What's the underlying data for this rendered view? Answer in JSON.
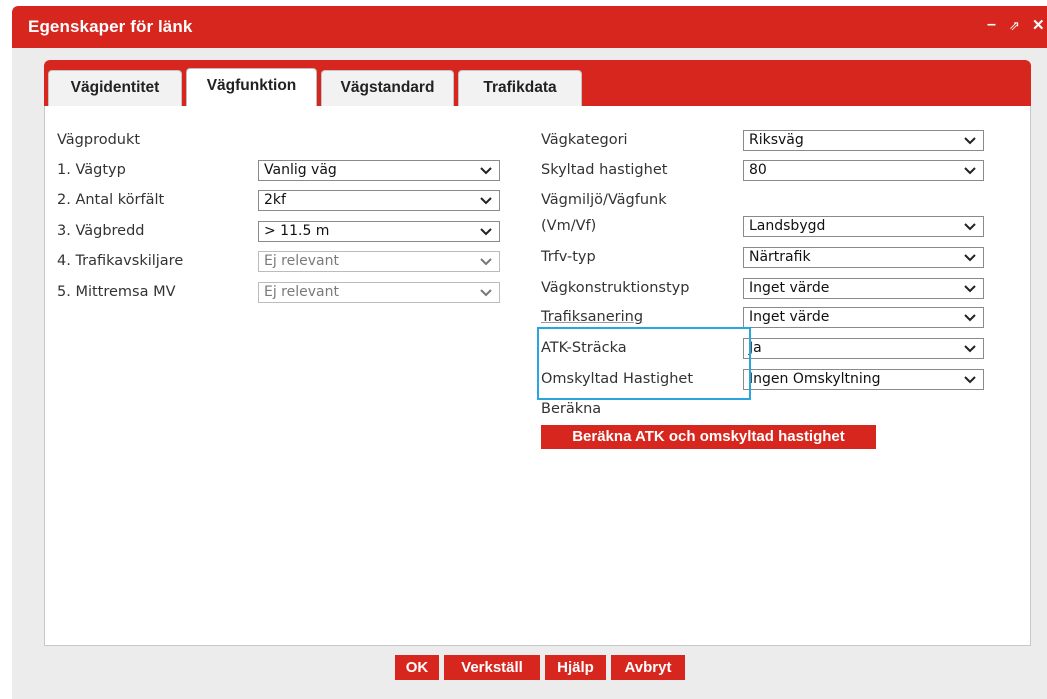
{
  "dialog": {
    "title": "Egenskaper för länk",
    "minimize_glyph": "–",
    "popout_glyph": "⇗",
    "close_glyph": "✕"
  },
  "tabs": [
    {
      "label": "Vägidentitet",
      "active": false
    },
    {
      "label": "Vägfunktion",
      "active": true
    },
    {
      "label": "Vägstandard",
      "active": false
    },
    {
      "label": "Trafikdata",
      "active": false
    }
  ],
  "left": {
    "section_heading": "Vägprodukt",
    "fields": [
      {
        "label": "1. Vägtyp",
        "value": "Vanlig väg",
        "disabled": false
      },
      {
        "label": "2. Antal körfält",
        "value": "2kf",
        "disabled": false
      },
      {
        "label": "3. Vägbredd",
        "value": "> 11.5 m",
        "disabled": false
      },
      {
        "label": "4. Trafikavskiljare",
        "value": "Ej relevant",
        "disabled": true
      },
      {
        "label": "5. Mittremsa MV",
        "value": "Ej relevant",
        "disabled": true
      }
    ]
  },
  "right": {
    "fields": [
      {
        "label": "Vägkategori",
        "value": "Riksväg"
      },
      {
        "label": "Skyltad hastighet",
        "value": "80"
      },
      {
        "label_line1": "Vägmiljö/Vägfunk",
        "label_line2": "(Vm/Vf)",
        "value": "Landsbygd"
      },
      {
        "label": "Trfv-typ",
        "value": "Närtrafik"
      },
      {
        "label": "Vägkonstruktionstyp",
        "value": "Inget värde"
      },
      {
        "label": "Trafiksanering",
        "value": "Inget värde"
      },
      {
        "label": "ATK-Sträcka",
        "value": "Ja"
      },
      {
        "label": "Omskyltad Hastighet",
        "value": "Ingen Omskyltning"
      }
    ],
    "compute_label": "Beräkna",
    "compute_button": "Beräkna ATK och omskyltad hastighet"
  },
  "footer": {
    "ok": "OK",
    "apply": "Verkställ",
    "help": "Hjälp",
    "cancel": "Avbryt"
  },
  "colors": {
    "accent": "#d7261e",
    "highlight": "#2aa6de",
    "panel_background": "#ffffff",
    "dialog_background": "#ececec"
  }
}
